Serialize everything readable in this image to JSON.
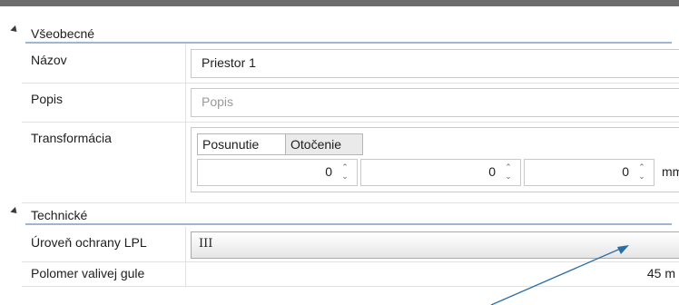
{
  "sections": {
    "general": {
      "title": "Všeobecné",
      "name_label": "Názov",
      "name_value": "Priestor 1",
      "description_label": "Popis",
      "description_placeholder": "Popis",
      "transform_label": "Transformácia",
      "tabs": [
        "Posunutie",
        "Otočenie"
      ],
      "offset_values": [
        "0",
        "0",
        "0"
      ],
      "unit": "mm"
    },
    "technical": {
      "title": "Technické",
      "lpl_label": "Úroveň ochrany LPL",
      "lpl_value": "III",
      "radius_label": "Polomer valivej gule",
      "radius_value": "45 m"
    }
  },
  "colors": {
    "section_underline": "#9fb6d2",
    "annotation_arrow": "#2a6ea6"
  }
}
